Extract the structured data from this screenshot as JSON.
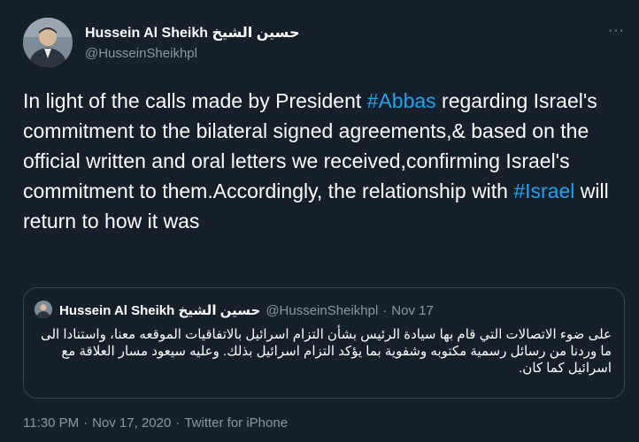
{
  "author": {
    "name": "Hussein Al Sheikh حسين الشيخ",
    "handle": "@HusseinSheikhpl"
  },
  "menu": {
    "more_icon": "more-horizontal-icon",
    "label": "···"
  },
  "tweet": {
    "part1": "In light of the calls made by President ",
    "hashtag1": "#Abbas",
    "part2": " regarding Israel's commitment to the bilateral signed agreements,& based on the official written and oral letters we received,confirming Israel's commitment to them.Accordingly, the relationship with ",
    "hashtag2": "#Israel",
    "part3": " will return to how it was"
  },
  "quoted_tweet": {
    "name": "Hussein Al Sheikh حسين الشيخ",
    "handle": "@HusseinSheikhpl",
    "separator": "·",
    "date": "Nov 17",
    "text": "على ضوء الاتصالات التي قام بها سيادة الرئيس بشأن التزام اسرائيل بالاتفاقيات الموقعه معنا، واستنادا الى ما وردنا من رسائل رسمية مكتوبه وشفوية بما يؤكد التزام اسرائيل بذلك. وعليه سيعود مسار العلاقة مع اسرائيل كما كان."
  },
  "meta": {
    "time": "11:30 PM",
    "separator": "·",
    "date": "Nov 17, 2020",
    "source": "Twitter for iPhone"
  },
  "colors": {
    "background": "#15202b",
    "text": "#ffffff",
    "secondary": "#8899a6",
    "link": "#1da1f2",
    "border": "#38444d"
  }
}
